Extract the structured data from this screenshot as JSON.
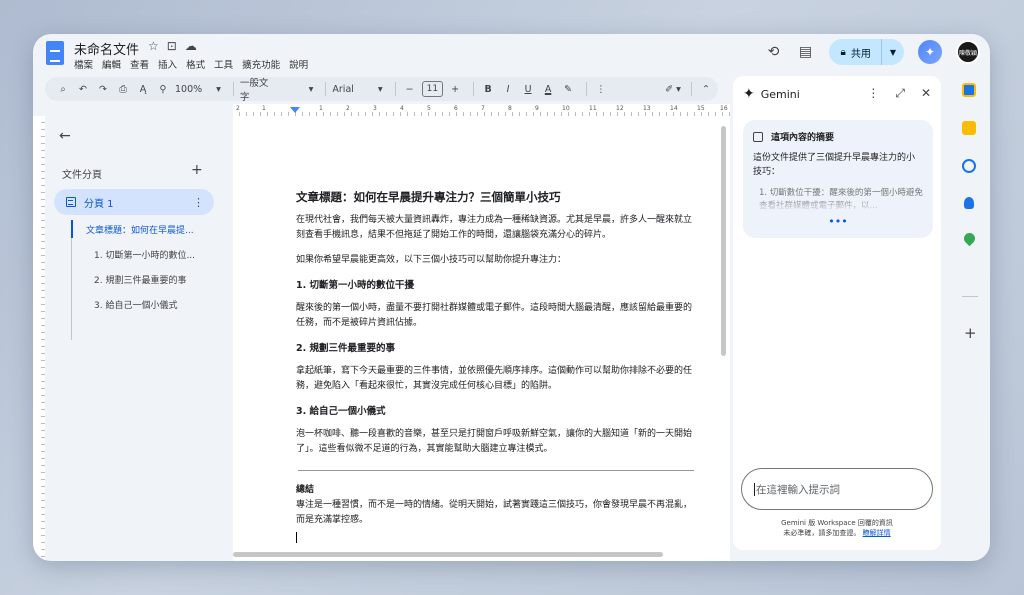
{
  "doc": {
    "title": "未命名文件",
    "menu": [
      "檔案",
      "編輯",
      "查看",
      "插入",
      "格式",
      "工具",
      "擴充功能",
      "說明"
    ]
  },
  "header": {
    "share_label": "共用",
    "user_initials": "陳敬穎"
  },
  "toolbar": {
    "zoom": "100%",
    "style": "一般文字",
    "font": "Arial",
    "font_size": "11"
  },
  "ruler": {
    "numbers": [
      "2",
      "1",
      "1",
      "2",
      "3",
      "4",
      "5",
      "6",
      "7",
      "8",
      "9",
      "10",
      "11",
      "12",
      "13",
      "14",
      "15",
      "16",
      "17"
    ]
  },
  "outline": {
    "title": "文件分頁",
    "tab_label": "分頁 1",
    "headings": [
      "文章標題：如何在早晨提...",
      "1. 切斷第一小時的數位...",
      "2. 規劃三件最重要的事",
      "3. 給自己一個小儀式"
    ]
  },
  "content": {
    "title": "文章標題：如何在早晨提升專注力？三個簡單小技巧",
    "intro1": "在現代社會，我們每天被大量資訊轟炸，專注力成為一種稀缺資源。尤其是早晨，許多人一醒來就立刻查看手機訊息，結果不但拖延了開始工作的時間，還讓腦袋充滿分心的碎片。",
    "intro2": "如果你希望早晨能更高效，以下三個小技巧可以幫助你提升專注力：",
    "h1": "1. 切斷第一小時的數位干擾",
    "p1": "醒來後的第一個小時，盡量不要打開社群媒體或電子郵件。這段時間大腦最清醒，應該留給最重要的任務，而不是被碎片資訊佔據。",
    "h2": "2. 規劃三件最重要的事",
    "p2": "拿起紙筆，寫下今天最重要的三件事情，並依照優先順序排序。這個動作可以幫助你排除不必要的任務，避免陷入「看起來很忙，其實沒完成任何核心目標」的陷阱。",
    "h3": "3. 給自己一個小儀式",
    "p3": "泡一杯咖啡、聽一段喜歡的音樂，甚至只是打開窗戶呼吸新鮮空氣，讓你的大腦知道「新的一天開始了」。這些看似微不足道的行為，其實能幫助大腦建立專注模式。",
    "summary_h": "總結",
    "summary_p": "專注是一種習慣，而不是一時的情緒。從明天開始，試著實踐這三個技巧，你會發現早晨不再混亂，而是充滿掌控感。"
  },
  "gemini": {
    "title": "Gemini",
    "card_title": "這項內容的摘要",
    "card_body": "這份文件提供了三個提升早晨專注力的小技巧：",
    "card_item": "1.  切斷數位干擾：醒來後的第一個小時避免查看社群媒體或電子郵件，以...",
    "more": "•••",
    "prompt_placeholder": "在這裡輸入提示詞",
    "disclaimer_line1": "Gemini 版 Workspace 回覆的資訊",
    "disclaimer_line2": "未必準確，請多加查證。",
    "learn_more": "瞭解詳情"
  }
}
